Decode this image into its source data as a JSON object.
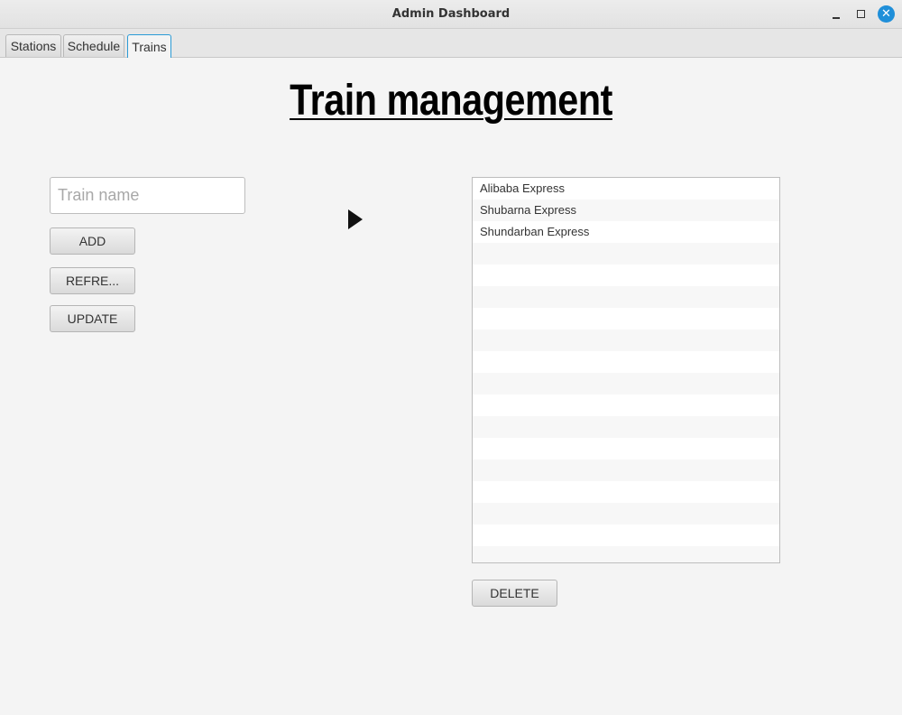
{
  "window": {
    "title": "Admin Dashboard"
  },
  "tabs": [
    {
      "label": "Stations"
    },
    {
      "label": "Schedule"
    },
    {
      "label": "Trains",
      "selected": true
    }
  ],
  "main": {
    "heading": "Train management",
    "train_name_input": {
      "value": "",
      "placeholder": "Train name"
    },
    "buttons": {
      "add": "ADD",
      "refresh": "REFRE...",
      "update": "UPDATE",
      "delete": "DELETE"
    },
    "trains": [
      "Alibaba Express",
      "Shubarna Express",
      "Shundarban Express"
    ]
  },
  "icons": {
    "minimize": "minimize-icon",
    "maximize": "maximize-icon",
    "close": "close-icon",
    "cursor": "mouse-pointer-icon"
  },
  "colors": {
    "accent": "#2b9bd6",
    "close": "#1f8fd9",
    "background": "#f4f4f4"
  }
}
